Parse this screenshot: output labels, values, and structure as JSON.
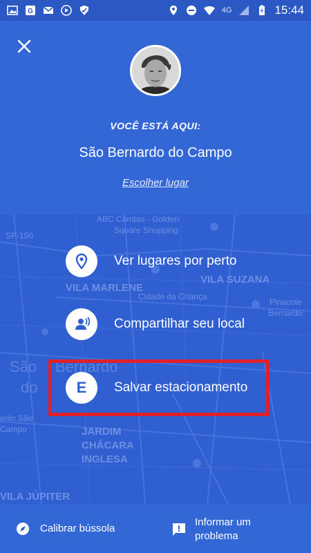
{
  "status_bar": {
    "left_icons": [
      "image-icon",
      "maps-notification-icon",
      "gmail-icon",
      "play-icon",
      "check-badge-icon"
    ],
    "right_icons": [
      "location-icon",
      "do-not-disturb-icon",
      "wifi-icon"
    ],
    "network": "4G",
    "time": "15:44"
  },
  "header": {
    "close_icon": "close-icon",
    "here_label": "VOCÊ ESTÁ AQUI:",
    "place_name": "São Bernardo do Campo",
    "choose_place_link": "Escolher lugar"
  },
  "map": {
    "labels": {
      "abc": "ABC Câmbio - Golden",
      "square": "Square Shopping",
      "sp150": "SP-150",
      "vila_marlene": "VILA MARLENE",
      "vila_suzana": "VILA SUZANA",
      "cidade_crianca": "Cidade da Criança",
      "pinacoteca": "Pinacote",
      "bernardo": "Bernardo",
      "sao": "São",
      "do": "do",
      "bernardo_big": "Bernardo",
      "jardim": "JARDIM",
      "chacara": "CHÁCARA",
      "inglesa": "INGLESA",
      "berlin": "erlin São",
      "campo": "Campo",
      "vila_jupiter": "VILA JÚPITER"
    }
  },
  "actions": [
    {
      "icon": "location-pin-icon",
      "label": "Ver lugares por perto"
    },
    {
      "icon": "share-location-icon",
      "label": "Compartilhar seu local"
    },
    {
      "icon": "parking-e-icon",
      "icon_letter": "E",
      "label": "Salvar estacionamento"
    }
  ],
  "bottom_bar": {
    "calibrate_label": "Calibrar bússola",
    "report_label": "Informar um problema"
  },
  "colors": {
    "background": "#2f5fd0",
    "header": "#3367d6",
    "highlight": "#e0202a"
  }
}
